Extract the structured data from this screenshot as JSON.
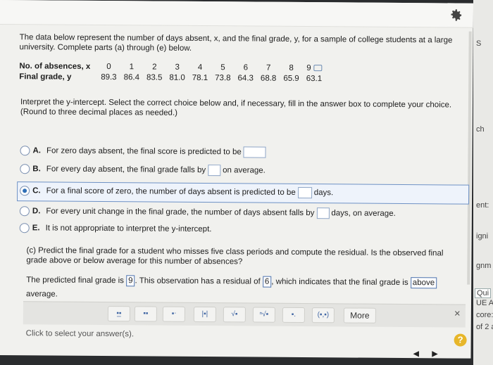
{
  "intro_text": "The data below represent the number of days absent, x, and the final grade, y, for a sample of college students at a large university. Complete parts (a) through (e) below.",
  "table": {
    "x_label": "No. of absences, x",
    "y_label": "Final grade, y",
    "x_values": [
      "0",
      "1",
      "2",
      "3",
      "4",
      "5",
      "6",
      "7",
      "8",
      "9"
    ],
    "y_values": [
      "89.3",
      "86.4",
      "83.5",
      "81.0",
      "78.1",
      "73.8",
      "64.3",
      "68.8",
      "65.9",
      "63.1"
    ]
  },
  "interpret": {
    "prompt": "Interpret the y-intercept. Select the correct choice below and, if necessary, fill in the answer box to complete your choice.",
    "instruction": "(Round to three decimal places as needed.)"
  },
  "choices": [
    {
      "letter": "A.",
      "before": "For zero days absent, the final score is predicted to be",
      "after": ""
    },
    {
      "letter": "B.",
      "before": "For every day absent, the final grade falls by",
      "after": "on average."
    },
    {
      "letter": "C.",
      "before": "For a final score of zero, the number of days absent is predicted to be",
      "after": "days."
    },
    {
      "letter": "D.",
      "before": "For every unit change in the final grade, the number of days absent falls by",
      "after": "days, on average."
    },
    {
      "letter": "E.",
      "before": "It is not appropriate to interpret the y-intercept.",
      "after": ""
    }
  ],
  "selected_choice": "C.",
  "part_c": {
    "question": "(c) Predict the final grade for a student who misses five class periods and compute the residual. Is the observed final grade above or below average for this number of absences?",
    "answer_pre": "The predicted final grade is",
    "predicted_value": "9",
    "answer_mid": ". This observation has a residual of",
    "residual_value": "6",
    "answer_mid2": ", which indicates that the final grade is",
    "above_below": "above",
    "answer_post": "average."
  },
  "toolbar": {
    "more_label": "More",
    "close_glyph": "×"
  },
  "status_text": "Click to select your answer(s).",
  "help_glyph": "?",
  "right_edge_fragments": [
    "S",
    "ch",
    "ent:",
    "igni",
    "gnm",
    "Qui",
    "UE AT",
    "core:",
    "of 2 at"
  ],
  "nav": {
    "prev": "◀",
    "next": "▶"
  },
  "colors": {
    "accent": "#2f6fb7",
    "help": "#e7b629",
    "selected_row_border": "#6e91c4"
  }
}
